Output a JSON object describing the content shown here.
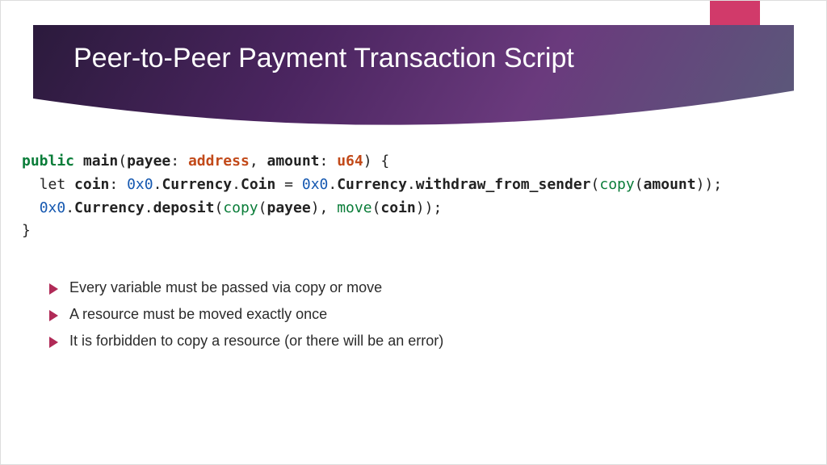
{
  "colors": {
    "ribbon": "#d13a6a",
    "bullet": "#b02a57",
    "header_grad_start": "#2b1a3c",
    "header_grad_end": "#5a5a7a"
  },
  "header": {
    "title": "Peer-to-Peer Payment Transaction Script"
  },
  "code": {
    "tokens": [
      [
        {
          "t": "public",
          "c": "kw-public"
        },
        {
          "t": " "
        },
        {
          "t": "main",
          "c": "plain-bold"
        },
        {
          "t": "("
        },
        {
          "t": "payee",
          "c": "plain-bold"
        },
        {
          "t": ": "
        },
        {
          "t": "address",
          "c": "kw-type"
        },
        {
          "t": ", "
        },
        {
          "t": "amount",
          "c": "plain-bold"
        },
        {
          "t": ": "
        },
        {
          "t": "u64",
          "c": "kw-type"
        },
        {
          "t": ") {"
        }
      ],
      [
        {
          "t": "  let "
        },
        {
          "t": "coin",
          "c": "plain-bold"
        },
        {
          "t": ": "
        },
        {
          "t": "0x0",
          "c": "kw-hex"
        },
        {
          "t": "."
        },
        {
          "t": "Currency",
          "c": "plain-bold"
        },
        {
          "t": "."
        },
        {
          "t": "Coin",
          "c": "plain-bold"
        },
        {
          "t": " = "
        },
        {
          "t": "0x0",
          "c": "kw-hex"
        },
        {
          "t": "."
        },
        {
          "t": "Currency",
          "c": "plain-bold"
        },
        {
          "t": "."
        },
        {
          "t": "withdraw_from_sender",
          "c": "plain-bold"
        },
        {
          "t": "("
        },
        {
          "t": "copy",
          "c": "kw-move"
        },
        {
          "t": "("
        },
        {
          "t": "amount",
          "c": "plain-bold"
        },
        {
          "t": "));"
        }
      ],
      [
        {
          "t": "  "
        },
        {
          "t": "0x0",
          "c": "kw-hex"
        },
        {
          "t": "."
        },
        {
          "t": "Currency",
          "c": "plain-bold"
        },
        {
          "t": "."
        },
        {
          "t": "deposit",
          "c": "plain-bold"
        },
        {
          "t": "("
        },
        {
          "t": "copy",
          "c": "kw-move"
        },
        {
          "t": "("
        },
        {
          "t": "payee",
          "c": "plain-bold"
        },
        {
          "t": "), "
        },
        {
          "t": "move",
          "c": "kw-move"
        },
        {
          "t": "("
        },
        {
          "t": "coin",
          "c": "plain-bold"
        },
        {
          "t": "));"
        }
      ],
      [
        {
          "t": "}"
        }
      ]
    ]
  },
  "bullets": [
    "Every variable must be passed via copy or move",
    "A resource must be moved exactly once",
    "It is forbidden to copy a resource (or there will be an error)"
  ]
}
